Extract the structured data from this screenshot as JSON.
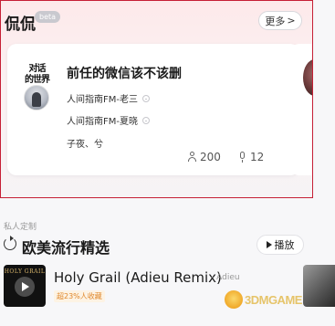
{
  "section": {
    "title": "侃侃",
    "badge": "beta",
    "more_label": "更多",
    "more_chevron": ">"
  },
  "room_card": {
    "avatar_logo_text": "对话\n的世界",
    "title": "前任的微信该不该删",
    "members": [
      "人间指南FM-老三",
      "人间指南FM-夏晓",
      "子夜、兮"
    ],
    "listeners": "200",
    "speakers": "12"
  },
  "playlist": {
    "label": "私人定制",
    "title": "欧美流行精选",
    "play_label": "播放"
  },
  "song": {
    "cover_text": "HOLY GRAIL",
    "title": "Holy Grail (Adieu Remix)",
    "artist": "- Adieu",
    "fav_badge": "超23%人收藏"
  },
  "watermark": {
    "text": "3DMGAME"
  },
  "colors": {
    "highlight_border": "#c62036",
    "badge_orange": "#e0872a"
  },
  "icons": {
    "more": "chevron-right-icon",
    "listeners": "person-icon",
    "speakers": "mic-icon",
    "refresh": "refresh-icon",
    "play": "play-icon"
  }
}
